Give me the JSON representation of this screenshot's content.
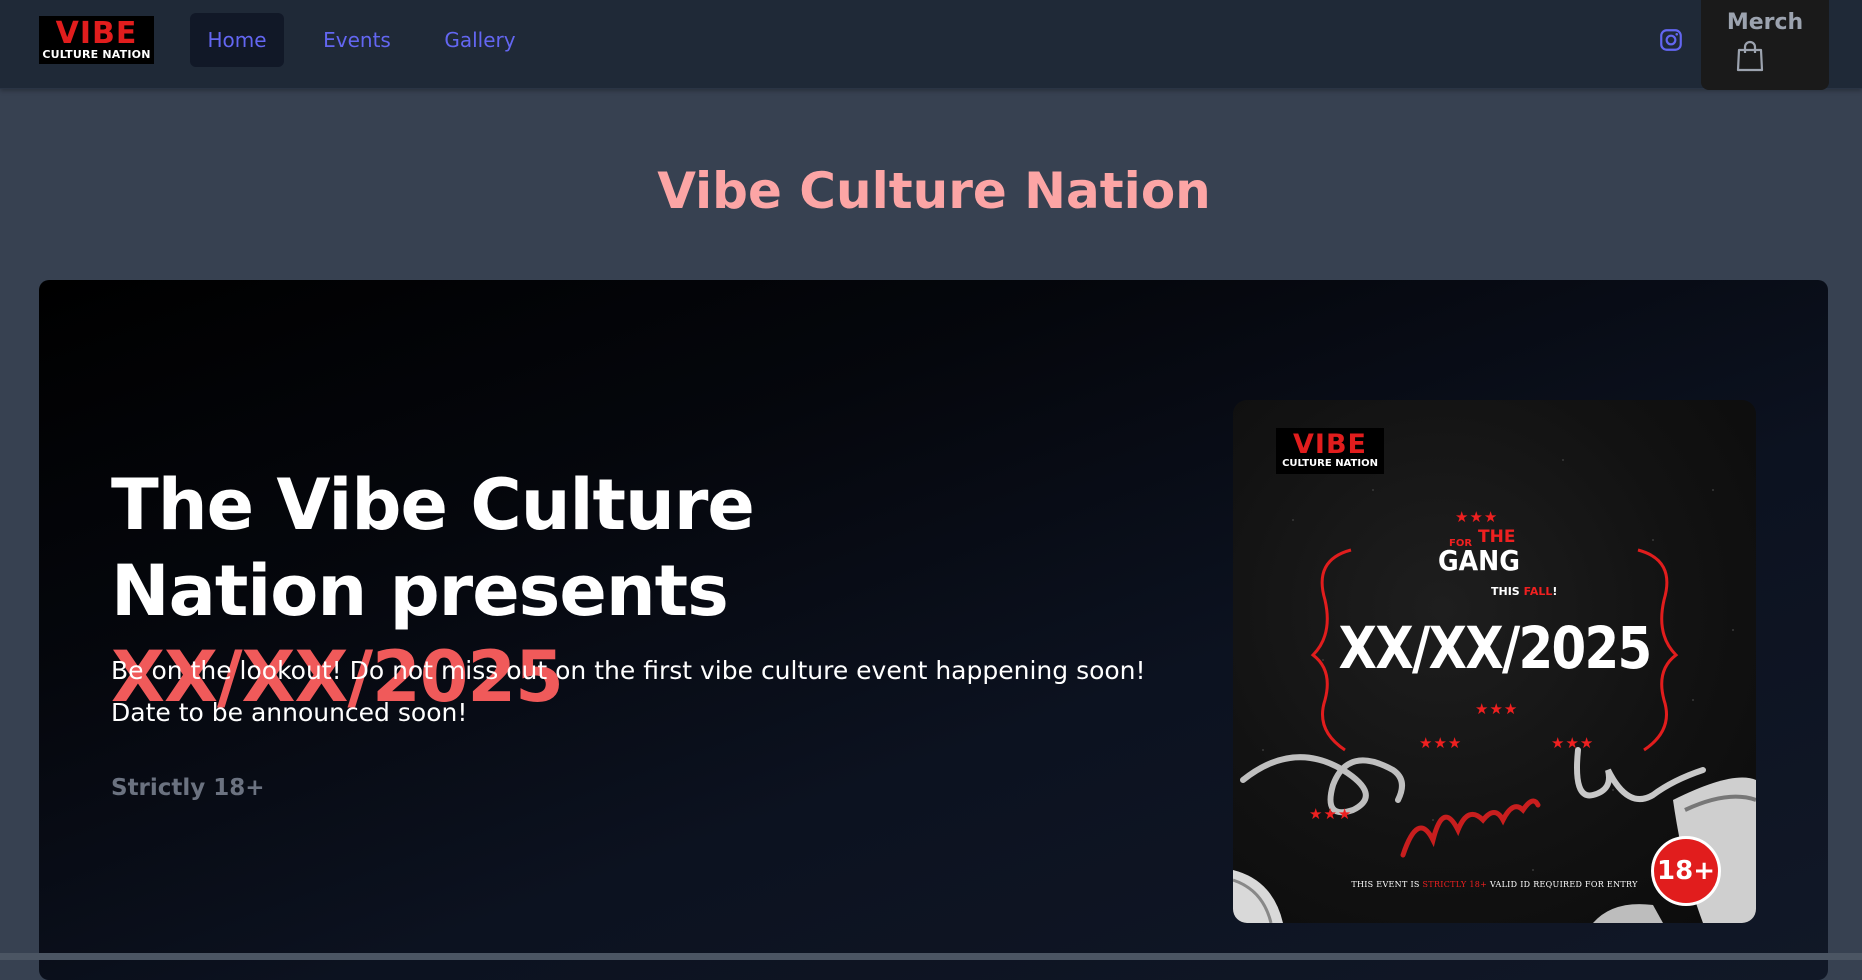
{
  "nav": {
    "logo": {
      "main": "VIBE",
      "sub": "CULTURE NATION"
    },
    "links": [
      {
        "label": "Home",
        "active": true
      },
      {
        "label": "Events",
        "active": false
      },
      {
        "label": "Gallery",
        "active": false
      }
    ],
    "icons": [
      "instagram-icon",
      "shopping-bag-icon"
    ],
    "merch_label": "Merch"
  },
  "page_title": "Vibe Culture Nation",
  "hero": {
    "heading_prefix": "The Vibe Culture Nation presents ",
    "heading_accent": "XX/XX/2025",
    "description": "Be on the lookout! Do not miss out on the first vibe culture event happening soon! Date to be announced soon!",
    "note": "Strictly 18+"
  },
  "poster": {
    "logo_main": "VIBE",
    "logo_sub": "CULTURE NATION",
    "for": "FOR",
    "the": "THE",
    "gang": "GANG",
    "this": "THIS ",
    "fall": "FALL",
    "exclaim": "!",
    "date": "XX/XX/2025",
    "footer_pre": "THIS EVENT IS ",
    "footer_strict": "STRICTLY 18+",
    "footer_post": " VALID ID REQUIRED FOR ENTRY",
    "badge": "18+"
  },
  "colors": {
    "accent": "#f05a5a",
    "title": "#fca5a5",
    "nav_link": "#6366f1",
    "navbar_bg": "#1f2937",
    "page_bg": "#374151"
  }
}
